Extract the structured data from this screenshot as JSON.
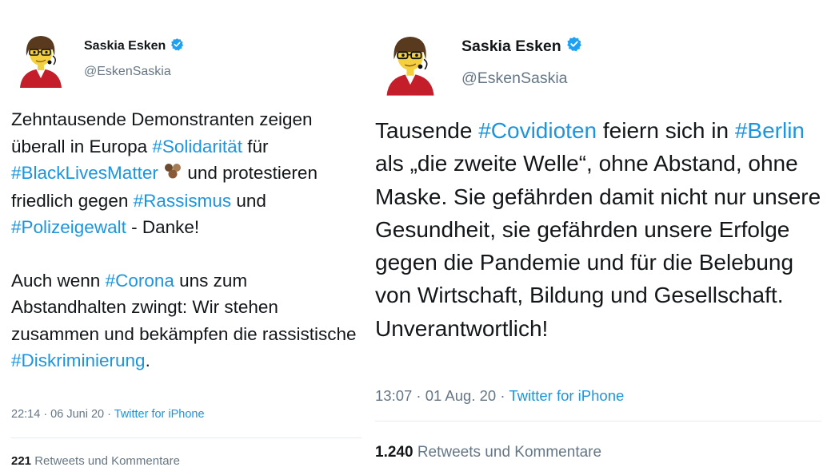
{
  "tweets": [
    {
      "author": {
        "name": "Saskia Esken",
        "handle": "@EskenSaskia",
        "verified": true
      },
      "paragraphs": [
        [
          {
            "text": "Zehntausende Demonstranten zeigen überall in Europa "
          },
          {
            "text": "#Solidarität",
            "tag": true
          },
          {
            "text": " für "
          },
          {
            "text": "#BlackLivesMatter",
            "tag": true
          },
          {
            "emoji": "raised-fist-icon"
          },
          {
            "text": " und protestieren friedlich gegen "
          },
          {
            "text": "#Rassismus",
            "tag": true
          },
          {
            "text": " und "
          },
          {
            "text": "#Polizeigewalt",
            "tag": true
          },
          {
            "text": " - Danke!"
          }
        ],
        [
          {
            "text": "Auch wenn "
          },
          {
            "text": "#Corona",
            "tag": true
          },
          {
            "text": " uns zum Abstandhalten zwingt: Wir stehen zusammen und bekämpfen die rassistische "
          },
          {
            "text": "#Diskriminierung",
            "tag": true
          },
          {
            "text": "."
          }
        ]
      ],
      "time": "22:14 · 06 Juni 20 · ",
      "source": "Twitter for iPhone",
      "retweets_count": "221",
      "retweets_label": " Retweets und Kommentare"
    },
    {
      "author": {
        "name": "Saskia Esken",
        "handle": "@EskenSaskia",
        "verified": true
      },
      "paragraphs": [
        [
          {
            "text": "Tausende "
          },
          {
            "text": "#Covidioten",
            "tag": true
          },
          {
            "text": " feiern sich in "
          },
          {
            "text": "#Berlin",
            "tag": true
          },
          {
            "text": " als „die zweite Welle“, ohne Abstand, ohne Maske. Sie gefährden damit nicht nur unsere Gesundheit, sie gefährden unsere Erfolge gegen die Pandemie und für die Belebung von Wirtschaft, Bildung und Gesellschaft. Unverantwortlich!"
          }
        ]
      ],
      "time": "13:07 · 01 Aug. 20 · ",
      "source": "Twitter for iPhone",
      "retweets_count": "1.240",
      "retweets_label": " Retweets und Kommentare"
    }
  ],
  "colors": {
    "hashtag": "#1b95e0",
    "verified": "#1da1f2",
    "muted": "#657786",
    "text": "#14171a"
  }
}
